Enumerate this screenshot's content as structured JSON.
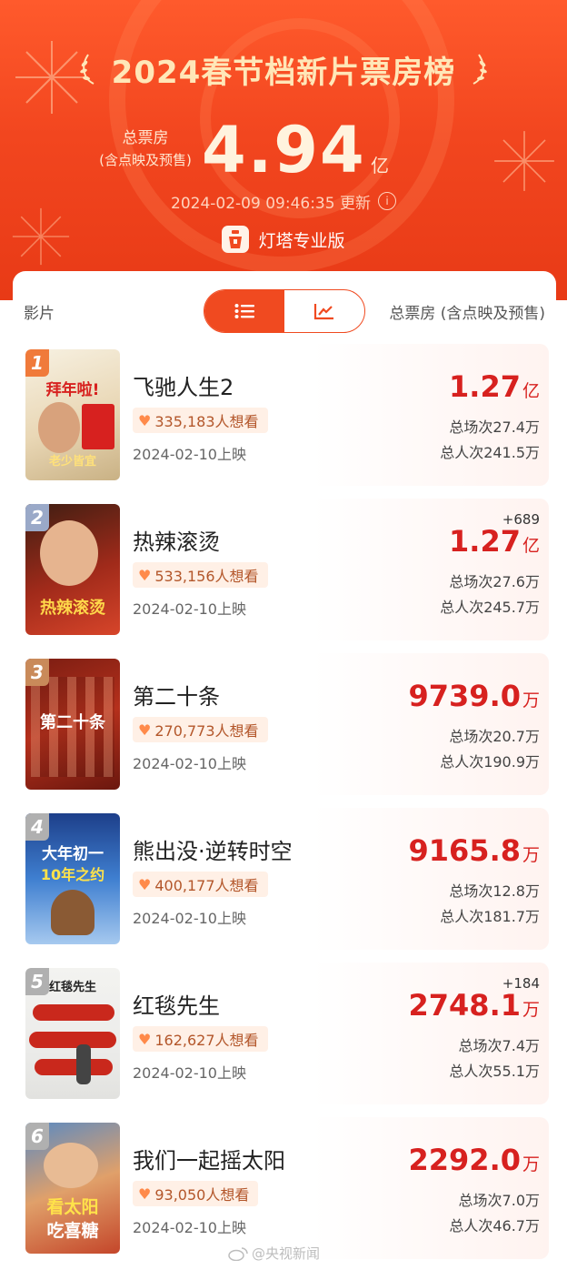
{
  "header": {
    "title": "2024春节档新片票房榜",
    "total_label_line1": "总票房",
    "total_label_line2": "(含点映及预售)",
    "total_value": "4.94",
    "total_unit": "亿",
    "update_time": "2024-02-09 09:46:35 更新",
    "brand": "灯塔专业版",
    "colors": {
      "header_bg": "#f2461f",
      "gold_text": "#ffe7b8"
    }
  },
  "table": {
    "col_film": "影片",
    "col_total": "总票房 (含点映及预售)",
    "view_toggle": {
      "list_icon": "list-icon",
      "chart_icon": "trend-chart-icon",
      "active": "list"
    }
  },
  "films": [
    {
      "rank": "1",
      "name": "飞驰人生2",
      "want": "335,183人想看",
      "release": "2024-02-10上映",
      "delta": "",
      "gross": "1.27",
      "unit": "亿",
      "shows": "总场次27.4万",
      "admits": "总人次241.5万",
      "rank_color": "#f07a3a",
      "poster_texts": [
        "拜年啦!",
        "老少皆宜"
      ]
    },
    {
      "rank": "2",
      "name": "热辣滚烫",
      "want": "533,156人想看",
      "release": "2024-02-10上映",
      "delta": "+689",
      "gross": "1.27",
      "unit": "亿",
      "shows": "总场次27.6万",
      "admits": "总人次245.7万",
      "rank_color": "#9aa9c8",
      "poster_texts": [
        "热辣滚烫"
      ]
    },
    {
      "rank": "3",
      "name": "第二十条",
      "want": "270,773人想看",
      "release": "2024-02-10上映",
      "delta": "",
      "gross": "9739.0",
      "unit": "万",
      "shows": "总场次20.7万",
      "admits": "总人次190.9万",
      "rank_color": "#c98a5a",
      "poster_texts": [
        "第二十条"
      ]
    },
    {
      "rank": "4",
      "name": "熊出没·逆转时空",
      "want": "400,177人想看",
      "release": "2024-02-10上映",
      "delta": "",
      "gross": "9165.8",
      "unit": "万",
      "shows": "总场次12.8万",
      "admits": "总人次181.7万",
      "rank_color": "#b0b0b0",
      "poster_texts": [
        "大年初一",
        "10年之约"
      ]
    },
    {
      "rank": "5",
      "name": "红毯先生",
      "want": "162,627人想看",
      "release": "2024-02-10上映",
      "delta": "+184",
      "gross": "2748.1",
      "unit": "万",
      "shows": "总场次7.4万",
      "admits": "总人次55.1万",
      "rank_color": "#b0b0b0",
      "poster_texts": [
        "红毯先生"
      ]
    },
    {
      "rank": "6",
      "name": "我们一起摇太阳",
      "want": "93,050人想看",
      "release": "2024-02-10上映",
      "delta": "",
      "gross": "2292.0",
      "unit": "万",
      "shows": "总场次7.0万",
      "admits": "总人次46.7万",
      "rank_color": "#b0b0b0",
      "poster_texts": [
        "看太阳",
        "吃喜糖"
      ]
    }
  ],
  "watermark": "@央视新闻"
}
